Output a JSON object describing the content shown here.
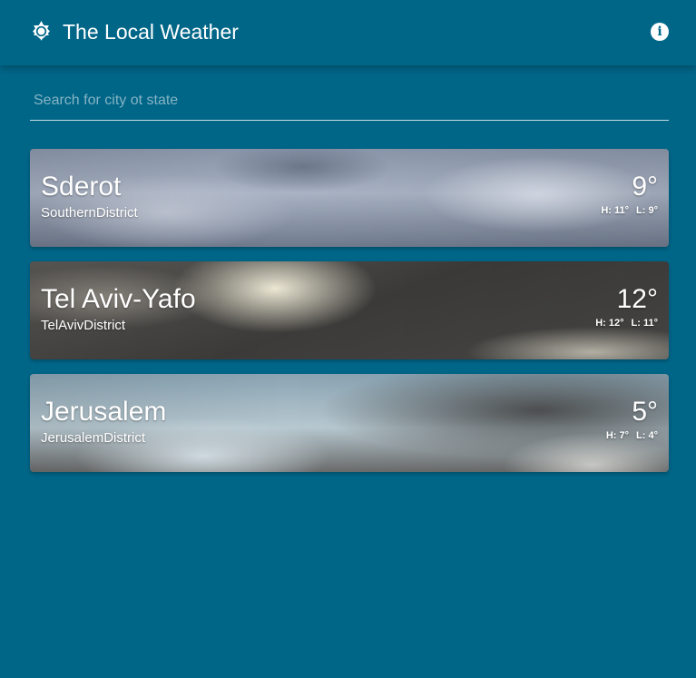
{
  "header": {
    "title": "The Local Weather",
    "logo_icon": "sun-icon",
    "info_icon": "info-icon",
    "info_glyph": "i"
  },
  "search": {
    "placeholder": "Search for city ot state",
    "value": ""
  },
  "cities": [
    {
      "name": "Sderot",
      "region": "SouthernDistrict",
      "temp": "9°",
      "high": "H: 11°",
      "low": "L: 9°"
    },
    {
      "name": "Tel Aviv-Yafo",
      "region": "TelAvivDistrict",
      "temp": "12°",
      "high": "H: 12°",
      "low": "L: 11°"
    },
    {
      "name": "Jerusalem",
      "region": "JerusalemDistrict",
      "temp": "5°",
      "high": "H: 7°",
      "low": "L: 4°"
    }
  ],
  "colors": {
    "background": "#006688",
    "text": "#ffffff"
  }
}
